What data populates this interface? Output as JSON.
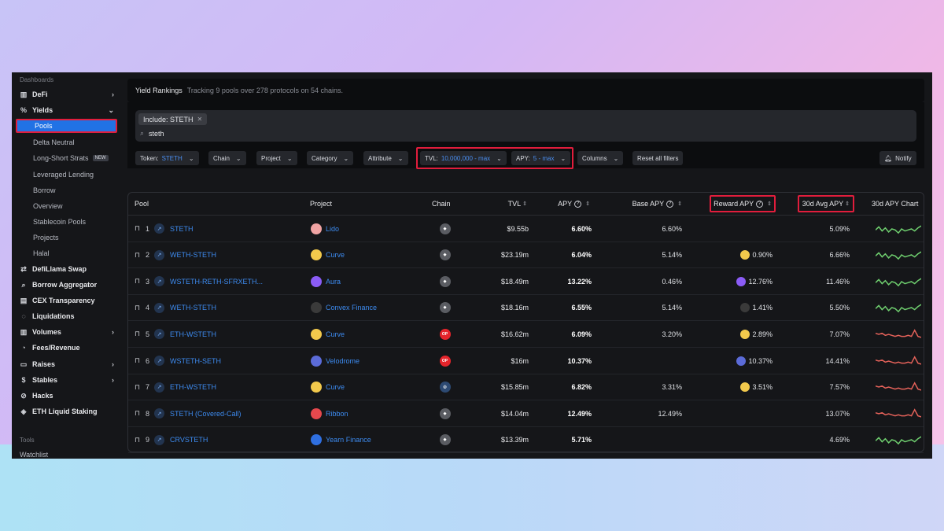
{
  "sidebar": {
    "dashboards_label": "Dashboards",
    "tools_label": "Tools",
    "items": [
      {
        "label": "DeFi"
      },
      {
        "label": "Yields"
      },
      {
        "label": "DefiLlama Swap"
      },
      {
        "label": "Borrow Aggregator"
      },
      {
        "label": "CEX Transparency"
      },
      {
        "label": "Liquidations"
      },
      {
        "label": "Volumes"
      },
      {
        "label": "Fees/Revenue"
      },
      {
        "label": "Raises"
      },
      {
        "label": "Stables"
      },
      {
        "label": "Hacks"
      },
      {
        "label": "ETH Liquid Staking"
      }
    ],
    "yields_sub": [
      "Pools",
      "Delta Neutral",
      "Long-Short Strats",
      "Leveraged Lending",
      "Borrow",
      "Overview",
      "Stablecoin Pools",
      "Projects",
      "Halal"
    ],
    "new_badge": "NEW",
    "watchlist": "Watchlist"
  },
  "header": {
    "title": "Yield Rankings",
    "subtitle": "Tracking 9 pools over 278 protocols on 54 chains."
  },
  "filters": {
    "chip": "Include: STETH",
    "search_value": "steth",
    "token_label": "Token:",
    "token_value": "STETH",
    "chain": "Chain",
    "project": "Project",
    "category": "Category",
    "attribute": "Attribute",
    "tvl_label": "TVL:",
    "tvl_value": "10,000,000 - max",
    "apy_label": "APY:",
    "apy_value": "5 - max",
    "columns": "Columns",
    "reset": "Reset all filters",
    "notify": "Notify"
  },
  "table": {
    "headers": {
      "pool": "Pool",
      "project": "Project",
      "chain": "Chain",
      "tvl": "TVL",
      "apy": "APY",
      "base_apy": "Base APY",
      "reward_apy": "Reward APY",
      "avg_apy": "30d Avg APY",
      "chart": "30d APY Chart"
    },
    "rows": [
      {
        "rank": "1",
        "pool": "STETH",
        "project": "Lido",
        "proj_color": "#f0a3a3",
        "chain": "eth",
        "tvl": "$9.55b",
        "apy": "6.60%",
        "base": "6.60%",
        "reward": "",
        "avg": "5.09%",
        "spark": "green"
      },
      {
        "rank": "2",
        "pool": "WETH-STETH",
        "project": "Curve",
        "proj_color": "#f2c94c",
        "chain": "eth",
        "tvl": "$23.19m",
        "apy": "6.04%",
        "base": "5.14%",
        "reward": "0.90%",
        "avg": "6.66%",
        "spark": "green"
      },
      {
        "rank": "3",
        "pool": "WSTETH-RETH-SFRXETH...",
        "project": "Aura",
        "proj_color": "#8b5cf6",
        "chain": "eth",
        "tvl": "$18.49m",
        "apy": "13.22%",
        "base": "0.46%",
        "reward": "12.76%",
        "avg": "11.46%",
        "spark": "green"
      },
      {
        "rank": "4",
        "pool": "WETH-STETH",
        "project": "Convex Finance",
        "proj_color": "#3a3a3a",
        "chain": "eth",
        "tvl": "$18.16m",
        "apy": "6.55%",
        "base": "5.14%",
        "reward": "1.41%",
        "avg": "5.50%",
        "spark": "green"
      },
      {
        "rank": "5",
        "pool": "ETH-WSTETH",
        "project": "Curve",
        "proj_color": "#f2c94c",
        "chain": "op",
        "tvl": "$16.62m",
        "apy": "6.09%",
        "base": "3.20%",
        "reward": "2.89%",
        "avg": "7.07%",
        "spark": "red"
      },
      {
        "rank": "6",
        "pool": "WSTETH-SETH",
        "project": "Velodrome",
        "proj_color": "#5b6bd8",
        "chain": "op",
        "tvl": "$16m",
        "apy": "10.37%",
        "base": "",
        "reward": "10.37%",
        "avg": "14.41%",
        "spark": "red"
      },
      {
        "rank": "7",
        "pool": "ETH-WSTETH",
        "project": "Curve",
        "proj_color": "#f2c94c",
        "chain": "arb",
        "tvl": "$15.85m",
        "apy": "6.82%",
        "base": "3.31%",
        "reward": "3.51%",
        "avg": "7.57%",
        "spark": "red"
      },
      {
        "rank": "8",
        "pool": "STETH (Covered-Call)",
        "project": "Ribbon",
        "proj_color": "#e5484d",
        "chain": "eth",
        "tvl": "$14.04m",
        "apy": "12.49%",
        "base": "12.49%",
        "reward": "",
        "avg": "13.07%",
        "spark": "red"
      },
      {
        "rank": "9",
        "pool": "CRVSTETH",
        "project": "Yearn Finance",
        "proj_color": "#2f6fe0",
        "chain": "eth",
        "tvl": "$13.39m",
        "apy": "5.71%",
        "base": "",
        "reward": "",
        "avg": "4.69%",
        "spark": "green"
      }
    ]
  },
  "colors": {
    "accent": "#2172e5",
    "link": "#3d8bf0",
    "highlight_box": "#e11d3c",
    "spark_green": "#6fcf6f",
    "spark_red": "#e5625a"
  }
}
